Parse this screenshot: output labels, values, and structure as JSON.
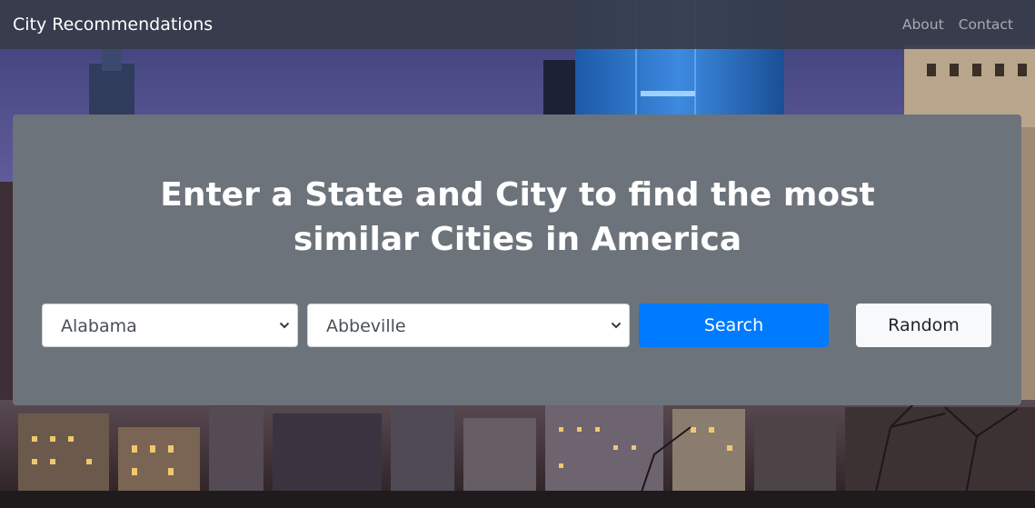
{
  "navbar": {
    "brand": "City Recommendations",
    "links": [
      "About",
      "Contact"
    ]
  },
  "hero": {
    "headline_line1": "Enter a State and City to find the most",
    "headline_line2": "similar Cities in America"
  },
  "form": {
    "state_select": {
      "selected": "Alabama"
    },
    "city_select": {
      "selected": "Abbeville"
    },
    "search_label": "Search",
    "random_label": "Random"
  },
  "colors": {
    "navbar": "#373c48",
    "panel": "#6c737b",
    "primary": "#007bff",
    "light": "#f8f9fa"
  },
  "icons": {
    "select_arrow": "chevron-down-icon"
  }
}
